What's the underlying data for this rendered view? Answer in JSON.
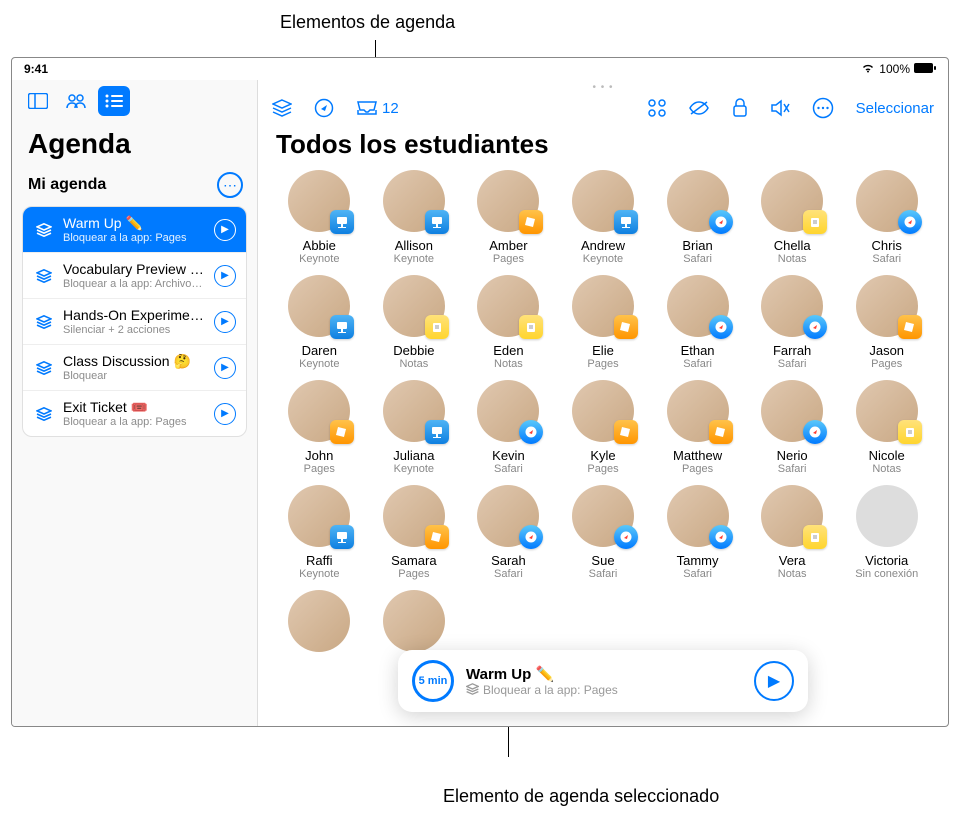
{
  "callouts": {
    "top": "Elementos de agenda",
    "bottom": "Elemento de agenda seleccionado"
  },
  "status": {
    "time": "9:41",
    "battery": "100%"
  },
  "sidebar": {
    "title": "Agenda",
    "my_agenda": "Mi agenda",
    "items": [
      {
        "name": "Warm Up ✏️",
        "sub": "Bloquear a la app: Pages",
        "selected": true
      },
      {
        "name": "Vocabulary Preview 💡",
        "sub": "Bloquear a la app: Archivos +…",
        "selected": false
      },
      {
        "name": "Hands-On Experiment 🧪",
        "sub": "Silenciar + 2 acciones",
        "selected": false
      },
      {
        "name": "Class Discussion 🤔",
        "sub": "Bloquear",
        "selected": false
      },
      {
        "name": "Exit Ticket 🎟️",
        "sub": "Bloquear a la app: Pages",
        "selected": false
      }
    ]
  },
  "content": {
    "inbox_count": "12",
    "select_label": "Seleccionar",
    "title": "Todos los estudiantes",
    "students": [
      {
        "name": "Abbie",
        "app": "Keynote",
        "badge": "keynote"
      },
      {
        "name": "Allison",
        "app": "Keynote",
        "badge": "keynote"
      },
      {
        "name": "Amber",
        "app": "Pages",
        "badge": "pages"
      },
      {
        "name": "Andrew",
        "app": "Keynote",
        "badge": "keynote"
      },
      {
        "name": "Brian",
        "app": "Safari",
        "badge": "safari"
      },
      {
        "name": "Chella",
        "app": "Notas",
        "badge": "notas"
      },
      {
        "name": "Chris",
        "app": "Safari",
        "badge": "safari"
      },
      {
        "name": "Daren",
        "app": "Keynote",
        "badge": "keynote"
      },
      {
        "name": "Debbie",
        "app": "Notas",
        "badge": "notas"
      },
      {
        "name": "Eden",
        "app": "Notas",
        "badge": "notas"
      },
      {
        "name": "Elie",
        "app": "Pages",
        "badge": "pages"
      },
      {
        "name": "Ethan",
        "app": "Safari",
        "badge": "safari"
      },
      {
        "name": "Farrah",
        "app": "Safari",
        "badge": "safari"
      },
      {
        "name": "Jason",
        "app": "Pages",
        "badge": "pages"
      },
      {
        "name": "John",
        "app": "Pages",
        "badge": "pages"
      },
      {
        "name": "Juliana",
        "app": "Keynote",
        "badge": "keynote"
      },
      {
        "name": "Kevin",
        "app": "Safari",
        "badge": "safari"
      },
      {
        "name": "Kyle",
        "app": "Pages",
        "badge": "pages"
      },
      {
        "name": "Matthew",
        "app": "Pages",
        "badge": "pages"
      },
      {
        "name": "Nerio",
        "app": "Safari",
        "badge": "safari"
      },
      {
        "name": "Nicole",
        "app": "Notas",
        "badge": "notas"
      },
      {
        "name": "Raffi",
        "app": "Keynote",
        "badge": "keynote"
      },
      {
        "name": "Samara",
        "app": "Pages",
        "badge": "pages"
      },
      {
        "name": "Sarah",
        "app": "Safari",
        "badge": "safari"
      },
      {
        "name": "Sue",
        "app": "Safari",
        "badge": "safari"
      },
      {
        "name": "Tammy",
        "app": "Safari",
        "badge": "safari"
      },
      {
        "name": "Vera",
        "app": "Notas",
        "badge": "notas"
      },
      {
        "name": "Victoria",
        "app": "Sin conexión",
        "badge": "none"
      }
    ]
  },
  "pill": {
    "timer": "5 min",
    "title": "Warm Up ✏️",
    "sub": "Bloquear a la app: Pages"
  }
}
